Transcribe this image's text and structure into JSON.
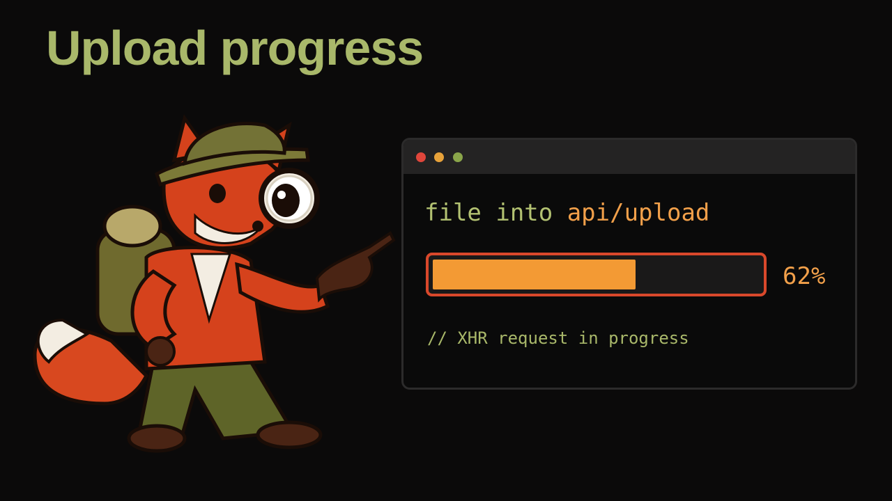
{
  "title": "Upload progress",
  "terminal": {
    "command_prefix": "file into ",
    "command_path": "api/upload",
    "progress_percent": 62,
    "progress_label": "62%",
    "comment": "// XHR request in progress"
  },
  "colors": {
    "title": "#a9b86a",
    "accent_orange": "#f39a34",
    "bar_border": "#d9482b",
    "code_green": "#b3c272"
  },
  "icons": {
    "window_controls": [
      "close-dot",
      "minimize-dot",
      "maximize-dot"
    ],
    "mascot": "fox-explorer-with-magnifying-glass"
  }
}
